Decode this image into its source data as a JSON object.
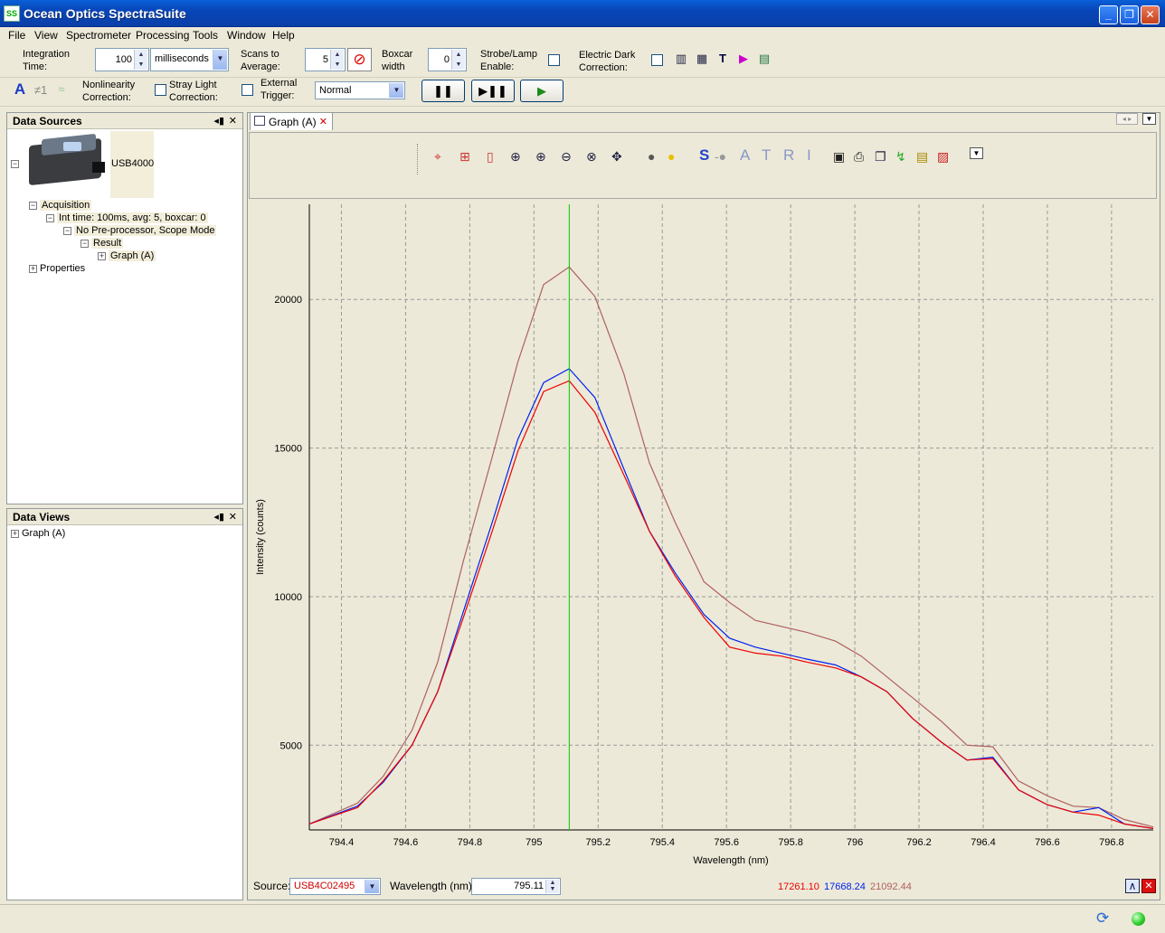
{
  "window": {
    "title": "Ocean Optics SpectraSuite",
    "icon_text": "SS"
  },
  "menu": [
    "File",
    "View",
    "Spectrometer",
    "Processing",
    "Tools",
    "Window",
    "Help"
  ],
  "acq": {
    "integration_label_1": "Integration",
    "integration_label_2": "Time:",
    "integration_value": "100",
    "integration_unit": "milliseconds",
    "scans_label_1": "Scans to",
    "scans_label_2": "Average:",
    "scans_value": "5",
    "boxcar_label_1": "Boxcar",
    "boxcar_label_2": "width",
    "boxcar_value": "0",
    "strobe_label_1": "Strobe/Lamp",
    "strobe_label_2": "Enable:",
    "dark_label_1": "Electric Dark",
    "dark_label_2": "Correction:",
    "nonlin_label_1": "Nonlinearity",
    "nonlin_label_2": "Correction:",
    "stray_label_1": "Stray Light",
    "stray_label_2": "Correction:",
    "trigger_label_1": "External",
    "trigger_label_2": "Trigger:",
    "trigger_value": "Normal"
  },
  "data_sources": {
    "title": "Data Sources",
    "device": "USB4000",
    "tree": [
      "Acquisition",
      "Int time: 100ms, avg: 5, boxcar: 0",
      "No Pre-processor, Scope Mode",
      "Result",
      "Graph (A)",
      "Properties"
    ]
  },
  "data_views": {
    "title": "Data Views",
    "items": [
      "Graph (A)"
    ]
  },
  "tab": {
    "label": "Graph (A)"
  },
  "chart_tools_letters": [
    "S",
    "A",
    "T",
    "R",
    "I"
  ],
  "bottom": {
    "source_label": "Source:",
    "source_value": "USB4C02495",
    "wavelength_label": "Wavelength (nm):",
    "wavelength_value": "795.11",
    "readout": [
      "17261.10",
      "17668.24",
      "21092.44"
    ]
  },
  "colors": {
    "red": "#ee0000",
    "blue": "#0022ee",
    "brown": "#b06060",
    "cursor": "#00cc00"
  },
  "chart_data": {
    "type": "line",
    "xlabel": "Wavelength (nm)",
    "ylabel": "Intensity (counts)",
    "xlim": [
      794.3,
      796.93
    ],
    "ylim": [
      2150,
      23200
    ],
    "x_ticks": [
      794.4,
      794.6,
      794.8,
      795,
      795.2,
      795.4,
      795.6,
      795.8,
      796,
      796.2,
      796.4,
      796.6,
      796.8
    ],
    "y_ticks": [
      5000,
      10000,
      15000,
      20000
    ],
    "grid": true,
    "cursor_x": 795.11,
    "x": [
      794.3,
      794.45,
      794.53,
      794.62,
      794.7,
      794.78,
      794.87,
      794.95,
      795.03,
      795.11,
      795.19,
      795.28,
      795.36,
      795.44,
      795.53,
      795.61,
      795.69,
      795.77,
      795.85,
      795.94,
      796.02,
      796.1,
      796.18,
      796.27,
      796.35,
      796.43,
      796.51,
      796.6,
      796.68,
      796.76,
      796.84,
      796.93
    ],
    "series": [
      {
        "color": "#ee0000",
        "values": [
          2350,
          2900,
          3800,
          5000,
          6800,
          9300,
          12200,
          14900,
          16900,
          17261,
          16200,
          14100,
          12200,
          10700,
          9300,
          8300,
          8100,
          8000,
          7800,
          7600,
          7300,
          6800,
          5900,
          5100,
          4500,
          4550,
          3500,
          3000,
          2750,
          2650,
          2350,
          2200
        ]
      },
      {
        "color": "#0022ee",
        "values": [
          2350,
          2950,
          3750,
          5000,
          6800,
          9500,
          12500,
          15300,
          17200,
          17668,
          16700,
          14300,
          12200,
          10800,
          9400,
          8600,
          8300,
          8100,
          7900,
          7700,
          7300,
          6800,
          5900,
          5100,
          4500,
          4600,
          3500,
          3000,
          2750,
          2900,
          2350,
          2200
        ]
      },
      {
        "color": "#b06060",
        "values": [
          2350,
          3050,
          3950,
          5500,
          7800,
          11200,
          14700,
          17900,
          20500,
          21092,
          20100,
          17500,
          14500,
          12500,
          10500,
          9800,
          9200,
          9000,
          8800,
          8500,
          8000,
          7300,
          6600,
          5800,
          5000,
          4950,
          3800,
          3300,
          2950,
          2900,
          2500,
          2250
        ]
      }
    ]
  }
}
